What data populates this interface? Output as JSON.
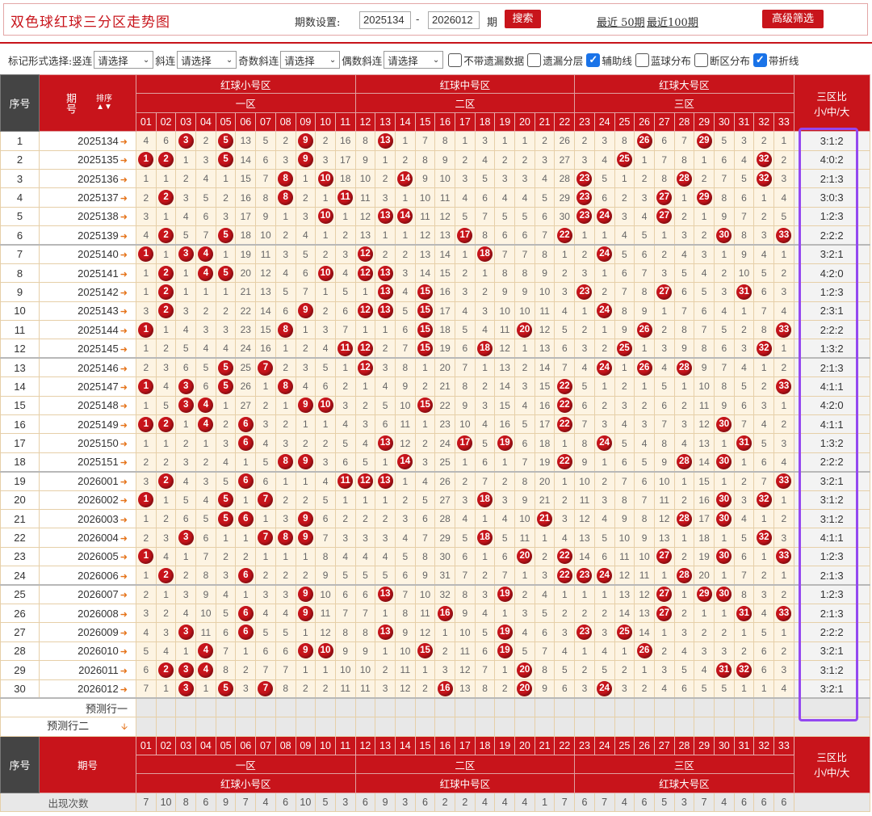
{
  "top": {
    "title": "双色球红球三分区走势图",
    "period_label": "期数设置:",
    "from": "2025134",
    "dash": "-",
    "to": "2026012",
    "unit": "期",
    "search": "搜索",
    "recent50": "最近 50期",
    "recent100": "最近100期",
    "advanced": "高级筛选"
  },
  "options": {
    "label": "标记形式选择:",
    "vert": "竖连",
    "slant": "斜连",
    "odd": "奇数斜连",
    "even": "偶数斜连",
    "select_placeholder": "请选择",
    "cb1": "不带遗漏数据",
    "cb2": "遗漏分层",
    "cb3": "辅助线",
    "cb4": "蓝球分布",
    "cb5": "断区分布",
    "cb6": "带折线"
  },
  "header": {
    "seq": "序号",
    "period": "期号",
    "sort": "排序",
    "z1_name": "红球小号区",
    "z2_name": "红球中号区",
    "z3_name": "红球大号区",
    "z1": "一区",
    "z2": "二区",
    "z3": "三区",
    "ratio1": "三区比",
    "ratio2": "小/中/大"
  },
  "rows": [
    {
      "n": "1",
      "p": "2025134",
      "v": [
        4,
        6,
        "3",
        2,
        "5",
        13,
        5,
        2,
        "9",
        2,
        16,
        8,
        "13",
        1,
        7,
        8,
        1,
        3,
        1,
        1,
        2,
        26,
        2,
        3,
        8,
        "26",
        6,
        7,
        "29",
        5,
        3,
        2,
        1
      ],
      "r": "3:1:2"
    },
    {
      "n": "2",
      "p": "2025135",
      "v": [
        "1",
        "2",
        1,
        3,
        "5",
        14,
        6,
        3,
        "9",
        3,
        17,
        9,
        1,
        2,
        8,
        9,
        2,
        4,
        2,
        2,
        3,
        27,
        3,
        4,
        "25",
        1,
        7,
        8,
        1,
        6,
        4,
        "32",
        2
      ],
      "r": "4:0:2"
    },
    {
      "n": "3",
      "p": "2025136",
      "v": [
        1,
        1,
        2,
        4,
        1,
        15,
        7,
        "8",
        1,
        "10",
        18,
        10,
        2,
        "14",
        9,
        10,
        3,
        5,
        3,
        3,
        4,
        28,
        "23",
        5,
        1,
        2,
        8,
        "28",
        2,
        7,
        5,
        "32",
        3
      ],
      "r": "2:1:3"
    },
    {
      "n": "4",
      "p": "2025137",
      "v": [
        2,
        "2",
        3,
        5,
        2,
        16,
        8,
        "8",
        2,
        1,
        "11",
        11,
        3,
        1,
        10,
        11,
        4,
        6,
        4,
        4,
        5,
        29,
        "23",
        6,
        2,
        3,
        "27",
        1,
        "29",
        8,
        6,
        1,
        4
      ],
      "r": "3:0:3"
    },
    {
      "n": "5",
      "p": "2025138",
      "v": [
        3,
        1,
        4,
        6,
        3,
        17,
        9,
        1,
        3,
        "10",
        1,
        12,
        "13",
        "14",
        11,
        12,
        5,
        7,
        5,
        5,
        6,
        30,
        "23",
        "24",
        3,
        4,
        "27",
        2,
        1,
        9,
        7,
        2,
        5
      ],
      "r": "1:2:3"
    },
    {
      "n": "6",
      "p": "2025139",
      "v": [
        4,
        "2",
        5,
        7,
        "5",
        18,
        10,
        2,
        4,
        1,
        2,
        13,
        1,
        1,
        12,
        13,
        "17",
        8,
        6,
        6,
        7,
        "22",
        1,
        1,
        4,
        5,
        1,
        3,
        2,
        "30",
        8,
        3,
        "33"
      ],
      "r": "2:2:2"
    },
    {
      "n": "7",
      "p": "2025140",
      "v": [
        "1",
        1,
        "3",
        "4",
        1,
        19,
        11,
        3,
        5,
        2,
        3,
        "12",
        2,
        2,
        13,
        14,
        1,
        "18",
        7,
        7,
        8,
        1,
        2,
        "24",
        5,
        6,
        2,
        4,
        3,
        1,
        9,
        4,
        1
      ],
      "r": "3:2:1"
    },
    {
      "n": "8",
      "p": "2025141",
      "v": [
        1,
        "2",
        1,
        "4",
        "5",
        20,
        12,
        4,
        6,
        "10",
        4,
        "12",
        "13",
        3,
        14,
        15,
        2,
        1,
        8,
        8,
        9,
        2,
        3,
        1,
        6,
        7,
        3,
        5,
        4,
        2,
        10,
        5,
        2
      ],
      "r": "4:2:0"
    },
    {
      "n": "9",
      "p": "2025142",
      "v": [
        1,
        "2",
        1,
        1,
        1,
        21,
        13,
        5,
        7,
        1,
        5,
        1,
        "13",
        4,
        "15",
        16,
        3,
        2,
        9,
        9,
        10,
        3,
        "23",
        2,
        7,
        8,
        "27",
        6,
        5,
        3,
        "31",
        6,
        3
      ],
      "r": "1:2:3"
    },
    {
      "n": "10",
      "p": "2025143",
      "v": [
        3,
        "2",
        3,
        2,
        2,
        22,
        14,
        6,
        "9",
        2,
        6,
        "12",
        "13",
        5,
        "15",
        17,
        4,
        3,
        10,
        10,
        11,
        4,
        1,
        "24",
        8,
        9,
        1,
        7,
        6,
        4,
        1,
        7,
        4
      ],
      "r": "2:3:1"
    },
    {
      "n": "11",
      "p": "2025144",
      "v": [
        "1",
        1,
        4,
        3,
        3,
        23,
        15,
        "8",
        1,
        3,
        7,
        1,
        1,
        6,
        "15",
        18,
        5,
        4,
        11,
        "20",
        12,
        5,
        2,
        1,
        9,
        "26",
        2,
        8,
        7,
        5,
        2,
        8,
        "33"
      ],
      "r": "2:2:2"
    },
    {
      "n": "12",
      "p": "2025145",
      "v": [
        1,
        2,
        5,
        4,
        4,
        24,
        16,
        1,
        2,
        4,
        "11",
        "12",
        2,
        7,
        "15",
        19,
        6,
        "18",
        12,
        1,
        13,
        6,
        3,
        2,
        "25",
        1,
        3,
        9,
        8,
        6,
        3,
        "32",
        1
      ],
      "r": "1:3:2"
    },
    {
      "n": "13",
      "p": "2025146",
      "v": [
        2,
        3,
        6,
        5,
        "5",
        25,
        "7",
        2,
        3,
        5,
        1,
        "12",
        3,
        8,
        1,
        20,
        7,
        1,
        13,
        2,
        14,
        7,
        4,
        "24",
        1,
        "26",
        4,
        "28",
        9,
        7,
        4,
        1,
        2
      ],
      "r": "2:1:3"
    },
    {
      "n": "14",
      "p": "2025147",
      "v": [
        "1",
        4,
        "3",
        6,
        "5",
        26,
        1,
        "8",
        4,
        6,
        2,
        1,
        4,
        9,
        2,
        21,
        8,
        2,
        14,
        3,
        15,
        "22",
        5,
        1,
        2,
        1,
        5,
        1,
        10,
        8,
        5,
        2,
        "33"
      ],
      "r": "4:1:1"
    },
    {
      "n": "15",
      "p": "2025148",
      "v": [
        1,
        5,
        "3",
        "4",
        1,
        27,
        2,
        1,
        "9",
        "10",
        3,
        2,
        5,
        10,
        "15",
        22,
        9,
        3,
        15,
        4,
        16,
        "22",
        6,
        2,
        3,
        2,
        6,
        2,
        11,
        9,
        6,
        3,
        1
      ],
      "r": "4:2:0"
    },
    {
      "n": "16",
      "p": "2025149",
      "v": [
        "1",
        "2",
        1,
        "4",
        2,
        "6",
        3,
        2,
        1,
        1,
        4,
        3,
        6,
        11,
        1,
        23,
        10,
        4,
        16,
        5,
        17,
        "22",
        7,
        3,
        4,
        3,
        7,
        3,
        12,
        "30",
        7,
        4,
        2
      ],
      "r": "4:1:1"
    },
    {
      "n": "17",
      "p": "2025150",
      "v": [
        1,
        1,
        2,
        1,
        3,
        "6",
        4,
        3,
        2,
        2,
        5,
        4,
        "13",
        12,
        2,
        24,
        "17",
        5,
        "19",
        6,
        18,
        1,
        8,
        "24",
        5,
        4,
        8,
        4,
        13,
        1,
        "31",
        5,
        3
      ],
      "r": "1:3:2"
    },
    {
      "n": "18",
      "p": "2025151",
      "v": [
        2,
        2,
        3,
        2,
        4,
        1,
        5,
        "8",
        "9",
        3,
        6,
        5,
        1,
        "14",
        3,
        25,
        1,
        6,
        1,
        7,
        19,
        "22",
        9,
        1,
        6,
        5,
        9,
        "28",
        14,
        "30",
        1,
        6,
        4
      ],
      "r": "2:2:2"
    },
    {
      "n": "19",
      "p": "2026001",
      "v": [
        3,
        "2",
        4,
        3,
        5,
        "6",
        6,
        1,
        1,
        4,
        "11",
        "12",
        "13",
        1,
        4,
        26,
        2,
        7,
        2,
        8,
        20,
        1,
        10,
        2,
        7,
        6,
        10,
        1,
        15,
        1,
        2,
        7,
        "33"
      ],
      "r": "3:2:1"
    },
    {
      "n": "20",
      "p": "2026002",
      "v": [
        "1",
        1,
        5,
        4,
        "5",
        1,
        "7",
        2,
        2,
        5,
        1,
        1,
        1,
        2,
        5,
        27,
        3,
        "18",
        3,
        9,
        21,
        2,
        11,
        3,
        8,
        7,
        11,
        2,
        16,
        "30",
        3,
        "32",
        1
      ],
      "r": "3:1:2"
    },
    {
      "n": "21",
      "p": "2026003",
      "v": [
        1,
        2,
        6,
        5,
        "5",
        "6",
        1,
        3,
        "9",
        6,
        2,
        2,
        2,
        3,
        6,
        28,
        4,
        1,
        4,
        10,
        "21",
        3,
        12,
        4,
        9,
        8,
        12,
        "28",
        17,
        "30",
        4,
        1,
        2
      ],
      "r": "3:1:2"
    },
    {
      "n": "22",
      "p": "2026004",
      "v": [
        2,
        3,
        "3",
        6,
        1,
        1,
        "7",
        "8",
        "9",
        7,
        3,
        3,
        3,
        4,
        7,
        29,
        5,
        "18",
        5,
        11,
        1,
        4,
        13,
        5,
        10,
        9,
        13,
        1,
        18,
        1,
        5,
        "32",
        3
      ],
      "r": "4:1:1"
    },
    {
      "n": "23",
      "p": "2026005",
      "v": [
        "1",
        4,
        1,
        7,
        2,
        2,
        1,
        1,
        1,
        8,
        4,
        4,
        4,
        5,
        8,
        30,
        6,
        1,
        6,
        "20",
        2,
        "22",
        14,
        6,
        11,
        10,
        "27",
        2,
        19,
        "30",
        6,
        1,
        "33"
      ],
      "r": "1:2:3"
    },
    {
      "n": "24",
      "p": "2026006",
      "v": [
        1,
        "2",
        2,
        8,
        3,
        "6",
        2,
        2,
        2,
        9,
        5,
        5,
        5,
        6,
        9,
        31,
        7,
        2,
        7,
        1,
        3,
        "22",
        "23",
        "24",
        12,
        11,
        1,
        "28",
        20,
        1,
        7,
        2,
        1
      ],
      "r": "2:1:3"
    },
    {
      "n": "25",
      "p": "2026007",
      "v": [
        2,
        1,
        3,
        9,
        4,
        1,
        3,
        3,
        "9",
        10,
        6,
        6,
        "13",
        7,
        10,
        32,
        8,
        3,
        "19",
        2,
        4,
        1,
        1,
        1,
        13,
        12,
        "27",
        1,
        "29",
        "30",
        8,
        3,
        2
      ],
      "r": "1:2:3"
    },
    {
      "n": "26",
      "p": "2026008",
      "v": [
        3,
        2,
        4,
        10,
        5,
        "6",
        4,
        4,
        "9",
        11,
        7,
        7,
        1,
        8,
        11,
        "16",
        9,
        4,
        1,
        3,
        5,
        2,
        2,
        2,
        14,
        13,
        "27",
        2,
        1,
        1,
        "31",
        4,
        "33"
      ],
      "r": "2:1:3"
    },
    {
      "n": "27",
      "p": "2026009",
      "v": [
        4,
        3,
        "3",
        11,
        6,
        "6",
        5,
        5,
        1,
        12,
        8,
        8,
        "13",
        9,
        12,
        1,
        10,
        5,
        "19",
        4,
        6,
        3,
        "23",
        3,
        "25",
        14,
        1,
        3,
        2,
        2,
        1,
        5,
        1
      ],
      "r": "2:2:2"
    },
    {
      "n": "28",
      "p": "2026010",
      "v": [
        5,
        4,
        1,
        "4",
        7,
        1,
        6,
        6,
        "9",
        "10",
        9,
        9,
        1,
        10,
        "15",
        2,
        11,
        6,
        "19",
        5,
        7,
        4,
        1,
        4,
        1,
        "26",
        2,
        4,
        3,
        3,
        2,
        6,
        2
      ],
      "r": "3:2:1"
    },
    {
      "n": "29",
      "p": "2026011",
      "v": [
        6,
        "2",
        "3",
        "4",
        8,
        2,
        7,
        7,
        1,
        1,
        10,
        10,
        2,
        11,
        1,
        3,
        12,
        7,
        1,
        "20",
        8,
        5,
        2,
        5,
        2,
        1,
        3,
        5,
        4,
        "31",
        "32",
        6,
        3
      ],
      "r": "3:1:2"
    },
    {
      "n": "30",
      "p": "2026012",
      "v": [
        7,
        1,
        "3",
        1,
        "5",
        3,
        "7",
        8,
        2,
        2,
        11,
        11,
        3,
        12,
        2,
        "16",
        13,
        8,
        2,
        "20",
        9,
        6,
        3,
        "24",
        3,
        2,
        4,
        6,
        5,
        5,
        1,
        1,
        4
      ],
      "r": "3:2:1"
    }
  ],
  "pred": {
    "row1": "预测行一",
    "row2": "预测行二"
  },
  "footer": {
    "count_label": "出现次数",
    "counts": [
      7,
      10,
      8,
      6,
      9,
      7,
      4,
      6,
      10,
      5,
      3,
      6,
      9,
      3,
      6,
      2,
      2,
      4,
      4,
      4,
      1,
      7,
      6,
      7,
      4,
      6,
      5,
      3,
      7,
      4,
      6,
      6,
      6
    ]
  },
  "colors": {
    "accent": "#c8141b",
    "highlight": "#9448f0"
  }
}
